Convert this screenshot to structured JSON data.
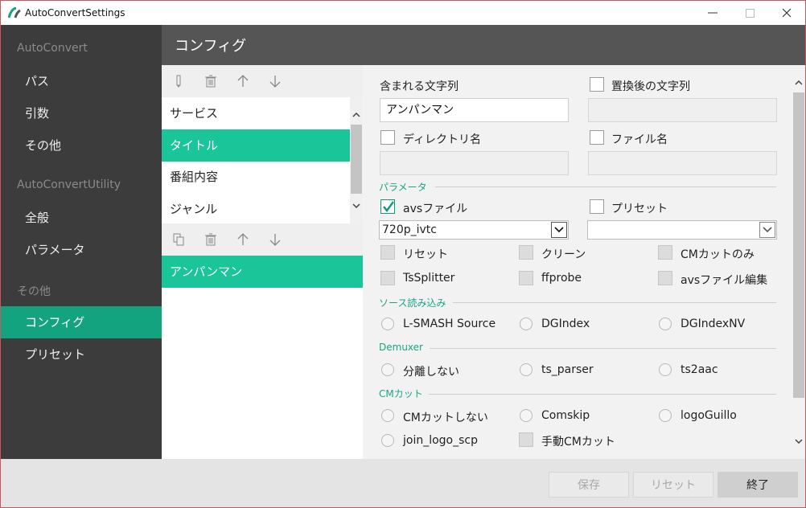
{
  "window": {
    "title": "AutoConvertSettings",
    "min_icon": "minimize-icon",
    "max_icon": "maximize-icon",
    "close_icon": "close-icon"
  },
  "sidebar": {
    "groups": [
      {
        "header": "AutoConvert",
        "items": [
          "パス",
          "引数",
          "その他"
        ]
      },
      {
        "header": "AutoConvertUtility",
        "items": [
          "全般",
          "パラメータ"
        ]
      },
      {
        "header": "その他",
        "items": [
          "コンフィグ",
          "プリセット"
        ]
      }
    ],
    "active": "コンフィグ"
  },
  "page": {
    "title": "コンフィグ"
  },
  "upper_list": {
    "items": [
      "サービス",
      "タイトル",
      "番組内容",
      "ジャンル"
    ],
    "selected": "タイトル"
  },
  "lower_list": {
    "items": [
      "アンパンマン"
    ],
    "selected": "アンパンマン"
  },
  "form": {
    "contains_label": "含まれる文字列",
    "contains_value": "アンパンマン",
    "replace_label": "置換後の文字列",
    "replace_value": "",
    "dirname_label": "ディレクトリ名",
    "filename_label": "ファイル名",
    "params_section": "パラメータ",
    "avs_label": "avsファイル",
    "avs_checked": true,
    "avs_select": "720p_ivtc",
    "preset_label": "プリセット",
    "preset_select": "",
    "checks": [
      "リセット",
      "クリーン",
      "CMカットのみ",
      "TsSplitter",
      "ffprobe",
      "avsファイル編集"
    ],
    "source_section": "ソース読み込み",
    "source_options": [
      "L-SMASH Source",
      "DGIndex",
      "DGIndexNV"
    ],
    "demux_section": "Demuxer",
    "demux_options": [
      "分離しない",
      "ts_parser",
      "ts2aac"
    ],
    "cm_section": "CMカット",
    "cm_options": [
      "CMカットしない",
      "Comskip",
      "logoGuillo",
      "join_logo_scp"
    ],
    "manual_cm_label": "手動CMカット"
  },
  "footer": {
    "save": "保存",
    "reset": "リセット",
    "close": "終了"
  },
  "colors": {
    "accent": "#14a37f",
    "accent_light": "#1ac699",
    "sidebar_bg": "#3c3c3c",
    "header_bg": "#555555"
  }
}
